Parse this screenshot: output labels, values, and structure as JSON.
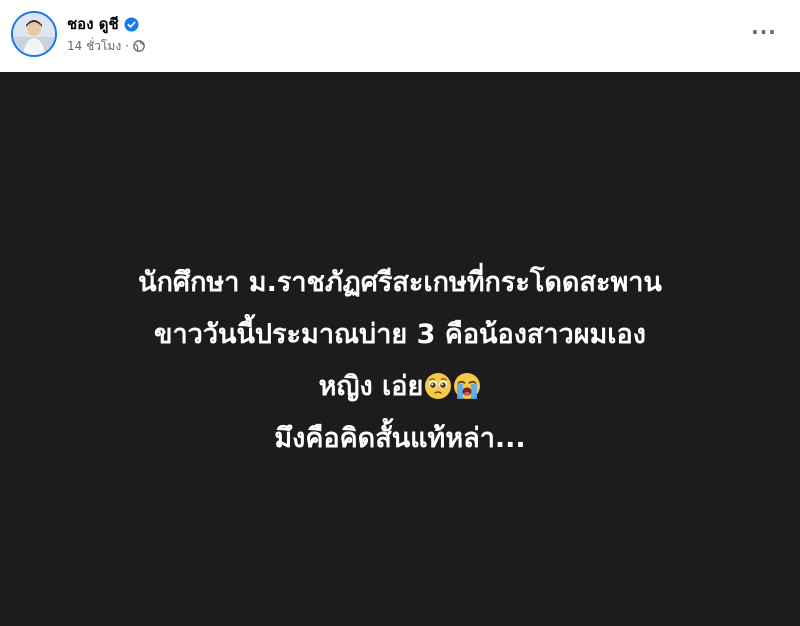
{
  "post": {
    "author_name": "ชอง ดูชี",
    "timestamp": "14 ชั่วโมง",
    "separator": "·",
    "privacy_icon": "globe-icon",
    "verified_icon": "verified-badge-icon",
    "more_icon": "more-options-icon",
    "more_label": "···"
  },
  "image": {
    "background_color": "#1c1c1c",
    "text_color": "#ffffff",
    "lines": [
      "นักศึกษา ม.ราชภัฏศรีสะเกษที่กระโดดสะพาน",
      "ขาววันนี้ประมาณบ่าย 3 คือน้องสาวผมเอง",
      "หญิง เอ่ย",
      "มึงคือคิดสั้นแท้หล่า..."
    ],
    "emojis": [
      "pleading-face-emoji",
      "loudly-crying-face-emoji"
    ]
  },
  "colors": {
    "accent": "#1877f2",
    "secondary_text": "#65676b"
  }
}
